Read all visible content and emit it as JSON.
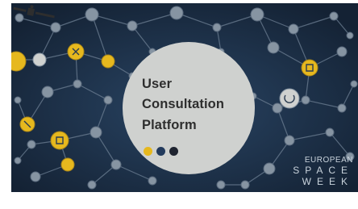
{
  "banner": {
    "title_lines": [
      "User",
      "Consultation",
      "Platform"
    ],
    "dot_colors": [
      "#e6b81e",
      "#223a5c",
      "#1f2430"
    ],
    "brand_lines": [
      "EUROPEAN",
      "SPACE",
      "WEEK"
    ],
    "colors": {
      "background": "#1d2f45",
      "network_node": "#8694a2",
      "highlight_node": "#e6b81e",
      "center_circle": "#cfd1cf"
    },
    "icons": [
      "satellite-icon",
      "network-node-icons"
    ]
  }
}
